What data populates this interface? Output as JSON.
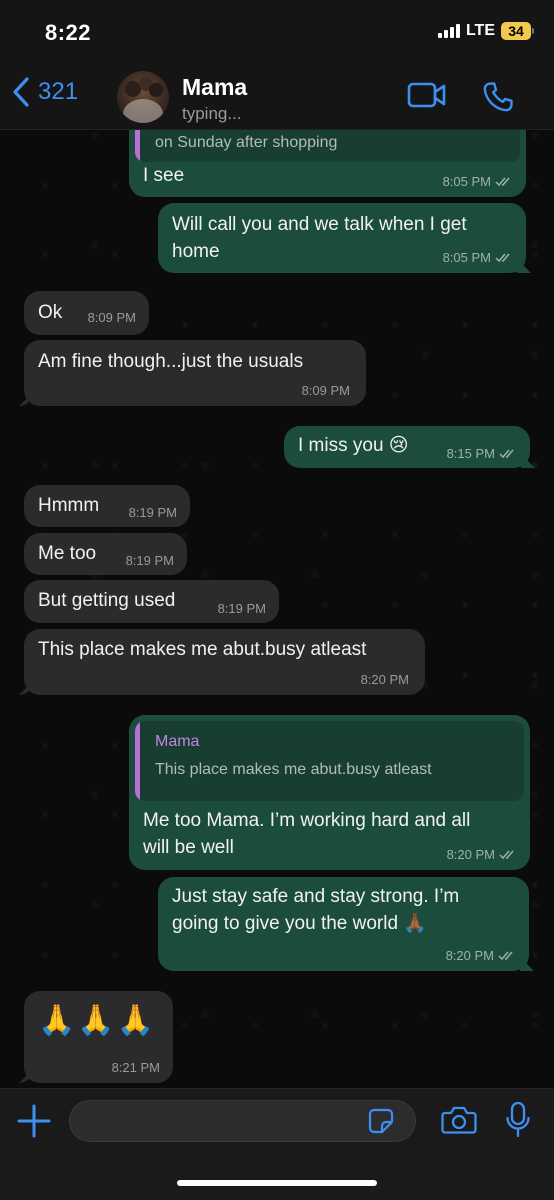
{
  "status_bar": {
    "time": "8:22",
    "network": "LTE",
    "battery": "34"
  },
  "header": {
    "back_count": "321",
    "contact_name": "Mama",
    "contact_status": "typing...",
    "icons": [
      "chevron-left-icon",
      "video-call-icon",
      "phone-icon"
    ]
  },
  "messages": [
    {
      "dir": "out",
      "quote_text": "on Sunday after shopping",
      "text": "I see",
      "time": "8:05 PM",
      "read": true
    },
    {
      "dir": "out",
      "text": "Will call you and we talk when I get\nhome",
      "time": "8:05 PM",
      "read": true
    },
    {
      "dir": "in",
      "text": "Ok",
      "time": "8:09 PM"
    },
    {
      "dir": "in",
      "text": "Am fine though...just the usuals",
      "time": "8:09 PM"
    },
    {
      "dir": "out",
      "text": "I miss you 😢",
      "time": "8:15 PM",
      "read": true
    },
    {
      "dir": "in",
      "text": "Hmmm",
      "time": "8:19 PM"
    },
    {
      "dir": "in",
      "text": "Me too",
      "time": "8:19 PM"
    },
    {
      "dir": "in",
      "text": "But getting used",
      "time": "8:19 PM"
    },
    {
      "dir": "in",
      "text": "This place makes me abut.busy atleast",
      "time": "8:20 PM"
    },
    {
      "dir": "out",
      "quote_name": "Mama",
      "quote_text": "This place makes me abut.busy atleast",
      "text": "Me too Mama. I’m working hard and all\nwill be well",
      "time": "8:20 PM",
      "read": true
    },
    {
      "dir": "out",
      "text": "Just stay safe and stay strong. I’m\ngoing to give you the world 🙏🏾",
      "time": "8:20 PM",
      "read": true
    },
    {
      "dir": "in",
      "text": "🙏🙏🙏",
      "time": "8:21 PM"
    }
  ],
  "input": {
    "placeholder": "",
    "icons": [
      "plus-icon",
      "sticker-icon",
      "camera-icon",
      "microphone-icon"
    ]
  },
  "colors": {
    "accent": "#3d8ff0",
    "outgoing_bubble": "#1c4d3c",
    "incoming_bubble": "#2b2b2d",
    "quote_bar": "#b96fd6"
  }
}
